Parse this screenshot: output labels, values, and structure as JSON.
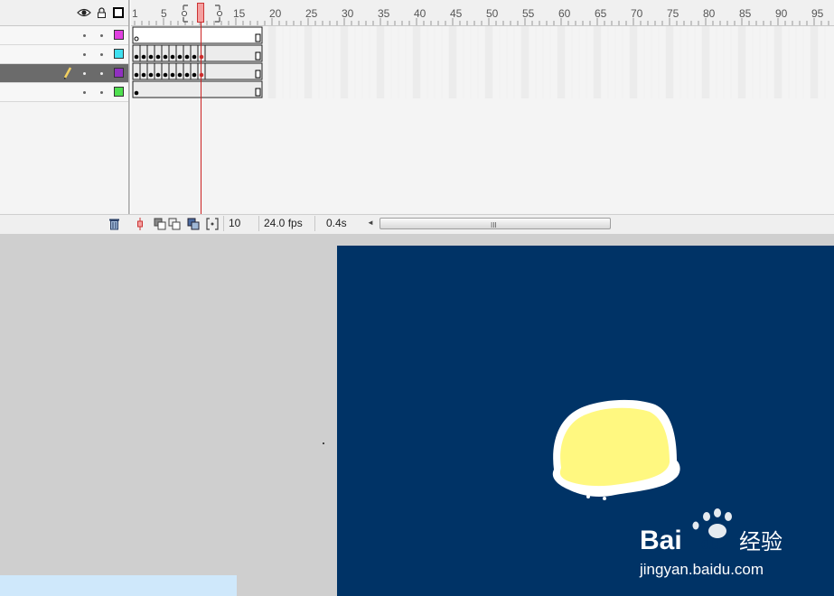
{
  "timeline": {
    "ruler_labels": [
      "1",
      "5",
      "10",
      "15",
      "20",
      "25",
      "30",
      "35",
      "40",
      "45",
      "50",
      "55",
      "60",
      "65",
      "70",
      "75",
      "80",
      "85",
      "90",
      "95"
    ],
    "current_frame": "10",
    "frame_rate": "24.0 fps",
    "elapsed_time": "0.4s",
    "scroll_grip": "III",
    "scroll_left_arrow": "◄",
    "layers": [
      {
        "color": "#e040e0",
        "active": false
      },
      {
        "color": "#40e0f0",
        "active": false
      },
      {
        "color": "#9030c0",
        "active": true
      },
      {
        "color": "#50e050",
        "active": false
      }
    ]
  },
  "icons": {
    "eye": "eye-icon",
    "lock": "lock-icon",
    "outline": "outline-square-icon",
    "pencil": "pencil-icon",
    "trash": "trash-icon",
    "center_frame": "center-frame-icon",
    "onion_skin": "onion-skin-icon",
    "onion_outlines": "onion-skin-outlines-icon",
    "edit_multiple": "edit-multiple-frames-icon",
    "onion_markers": "modify-onion-markers-icon"
  },
  "stage": {
    "background_color": "#003366",
    "shape_fill": "#fff880",
    "shape_stroke": "#ffffff"
  },
  "watermark": {
    "brand": "Bai",
    "brand_du": "du",
    "brand_suffix": "经验",
    "url": "jingyan.baidu.com"
  }
}
